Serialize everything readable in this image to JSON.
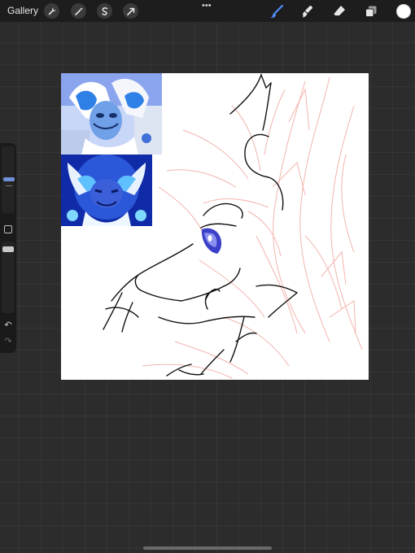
{
  "topbar": {
    "gallery_label": "Gallery",
    "left_tools": [
      "wrench-icon",
      "magic-wand-icon",
      "selection-icon",
      "transform-arrow-icon"
    ],
    "more_menu": "•••",
    "right_tools": [
      "brush-icon",
      "smudge-icon",
      "eraser-icon",
      "layers-icon"
    ],
    "brush_active_color": "#4f8ff7",
    "current_color": "#ffffff"
  },
  "sidebar": {
    "brush_size_level": 0.45,
    "opacity_level": 0.1,
    "undo_symbol": "↶",
    "redo_symbol": "↷"
  },
  "canvas": {
    "background": "#ffffff",
    "sketch_color": "#f0a8a0",
    "lineart_color": "#111111",
    "eye_color": "#3b40c8"
  },
  "reference_images": [
    {
      "label": "reference-image-1",
      "palette": [
        "#9fb8ff",
        "#2f7fe0",
        "#ffffff"
      ]
    },
    {
      "label": "reference-image-2",
      "palette": [
        "#1b3cbf",
        "#4fa8ff",
        "#ffffff"
      ]
    }
  ]
}
